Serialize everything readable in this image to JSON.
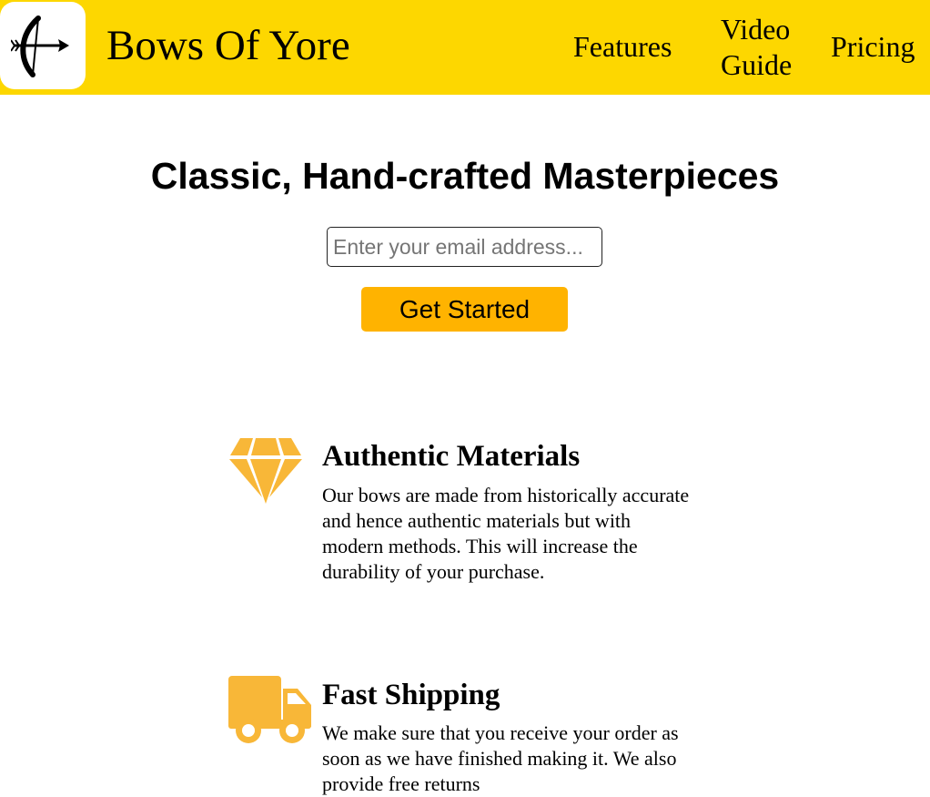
{
  "header": {
    "logo_icon": "bow-and-arrow-icon",
    "brand": "Bows Of Yore",
    "nav": [
      {
        "label": "Features"
      },
      {
        "label": "Video Guide"
      },
      {
        "label": "Pricing"
      }
    ],
    "background_color": "#fdd700"
  },
  "hero": {
    "title": "Classic, Hand-crafted Masterpieces",
    "email_placeholder": "Enter your email address...",
    "cta_label": "Get Started",
    "cta_color": "#ffb300"
  },
  "features": [
    {
      "icon": "diamond-icon",
      "title": "Authentic Materials",
      "text": "Our bows are made from historically accurate and hence authentic materials but with modern methods. This will increase the durability of your purchase."
    },
    {
      "icon": "truck-icon",
      "title": "Fast Shipping",
      "text": "We make sure that you receive your order as soon as we have finished making it. We also provide free returns"
    }
  ],
  "icon_color": "#f8b738"
}
